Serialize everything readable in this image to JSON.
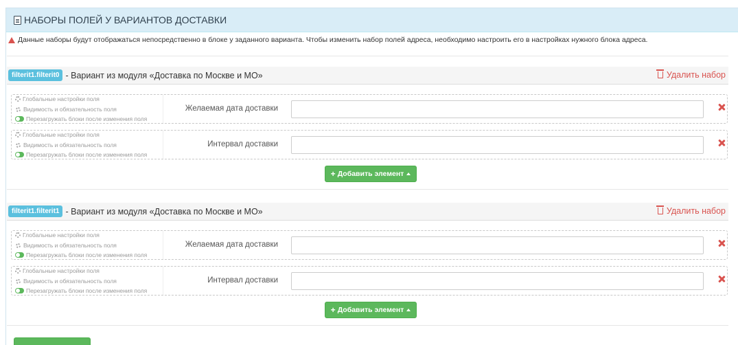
{
  "panel": {
    "title": "НАБОРЫ ПОЛЕЙ У ВАРИАНТОВ ДОСТАВКИ"
  },
  "notice": "Данные наборы будут отображаться непосредственно в блоке у заданного варианта. Чтобы изменить набор полей адреса, необходимо настроить его в настройках нужного блока адреса.",
  "field_options": {
    "global": "Глобальные настройки поля",
    "visibility": "Видимость и обязательность поля",
    "reload": "Перезагружать блоки после изменения поля"
  },
  "sets": [
    {
      "tag": "filterit1.filterit0",
      "title": "- Вариант из модуля «Доставка по Москве и МО»",
      "delete_label": "Удалить набор",
      "fields": [
        {
          "label": "Желаемая дата доставки",
          "value": ""
        },
        {
          "label": "Интервал доставки",
          "value": ""
        }
      ],
      "add_label": "Добавить элемент"
    },
    {
      "tag": "filterit1.filterit1",
      "title": "- Вариант из модуля «Доставка по Москве и МО»",
      "delete_label": "Удалить набор",
      "fields": [
        {
          "label": "Желаемая дата доставки",
          "value": ""
        },
        {
          "label": "Интервал доставки",
          "value": ""
        }
      ],
      "add_label": "Добавить элемент"
    }
  ],
  "colors": {
    "heading_bg": "#d9edf7",
    "tag": "#5bc0de",
    "danger": "#d9534f",
    "success": "#5cb85c"
  }
}
